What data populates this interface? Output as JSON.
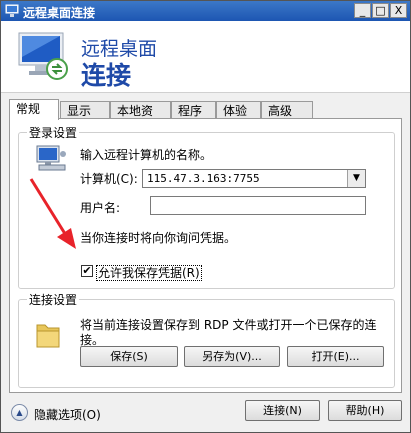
{
  "window": {
    "title": "远程桌面连接",
    "controls": {
      "minimize": "_",
      "maximize": "□",
      "close": "X"
    }
  },
  "header": {
    "line1": "远程桌面",
    "line2": "连接"
  },
  "tabs": [
    {
      "label": "常规",
      "active": true
    },
    {
      "label": "显示",
      "active": false
    },
    {
      "label": "本地资源",
      "active": false
    },
    {
      "label": "程序",
      "active": false
    },
    {
      "label": "体验",
      "active": false
    },
    {
      "label": "高级",
      "active": false
    }
  ],
  "login": {
    "legend": "登录设置",
    "prompt": "输入远程计算机的名称。",
    "computer_label": "计算机(C):",
    "computer_value": "115.47.3.163:7755",
    "username_label": "用户名:",
    "username_value": "",
    "info": "当你连接时将向你询问凭据。",
    "allow_save_label": "允许我保存凭据(R)",
    "allow_save_checked": "✔"
  },
  "connection": {
    "legend": "连接设置",
    "desc_line1": "将当前连接设置保存到 RDP 文件或打开一个已保存的连",
    "desc_line2": "接。",
    "save": "保存(S)",
    "save_as": "另存为(V)...",
    "open": "打开(E)..."
  },
  "footer": {
    "hide_options": "隐藏选项(O)",
    "connect": "连接(N)",
    "help": "帮助(H)"
  },
  "colors": {
    "accent": "#1f4aa8",
    "annotation_arrow": "#e8232a"
  }
}
